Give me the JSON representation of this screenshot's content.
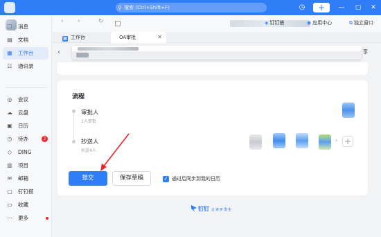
{
  "topbar": {
    "search_placeholder": "搜索 (Ctrl+Shift+F)",
    "icons": [
      "search-icon",
      "history-icon",
      "plus-icon",
      "minimize-icon",
      "maximize-icon",
      "close-icon"
    ],
    "plus": "+"
  },
  "sidebar": {
    "items": [
      {
        "label": "消息",
        "icon": "message-icon",
        "glyph": "☐"
      },
      {
        "label": "文档",
        "icon": "document-icon",
        "glyph": "▤"
      },
      {
        "label": "工作台",
        "icon": "workbench-icon",
        "glyph": "▦",
        "active": true
      },
      {
        "label": "通讯录",
        "icon": "contacts-icon",
        "glyph": "☷"
      },
      {
        "label": "会议",
        "icon": "meeting-icon",
        "glyph": "◎"
      },
      {
        "label": "云盘",
        "icon": "cloud-icon",
        "glyph": "☁"
      },
      {
        "label": "日历",
        "icon": "calendar-icon",
        "glyph": "▣"
      },
      {
        "label": "待办",
        "icon": "todo-icon",
        "glyph": "◷",
        "badge": "2"
      },
      {
        "label": "DING",
        "icon": "ding-icon",
        "glyph": "◇"
      },
      {
        "label": "项目",
        "icon": "project-icon",
        "glyph": "▥"
      },
      {
        "label": "邮箱",
        "icon": "mail-icon",
        "glyph": "✉"
      },
      {
        "label": "钉钉搭",
        "icon": "build-icon",
        "glyph": "▢"
      },
      {
        "label": "收藏",
        "icon": "favorite-icon",
        "glyph": "▭"
      },
      {
        "label": "更多",
        "icon": "more-icon",
        "glyph": "⋯",
        "dot": true
      }
    ]
  },
  "navbar": {
    "ding_label": "钉钉搭",
    "app_center_label": "应用中心",
    "standalone_label": "独立窗口"
  },
  "tabs": [
    {
      "label": "工作台"
    },
    {
      "label": "OA审批"
    }
  ],
  "page": {
    "share_label": "享",
    "section_title": "流程",
    "approver": {
      "label": "审批人",
      "sub": "1人审批"
    },
    "cc": {
      "label": "抄送人",
      "sub": "抄送4人"
    },
    "submit_label": "提交",
    "draft_label": "保存草稿",
    "sync_label": "通过后同步到我的日历"
  },
  "footer": {
    "brand": "钉钉",
    "tagline": "让进步发生"
  },
  "colors": {
    "accent": "#2f7df7",
    "badge": "#f5222d",
    "arrow": "#e8262b"
  }
}
